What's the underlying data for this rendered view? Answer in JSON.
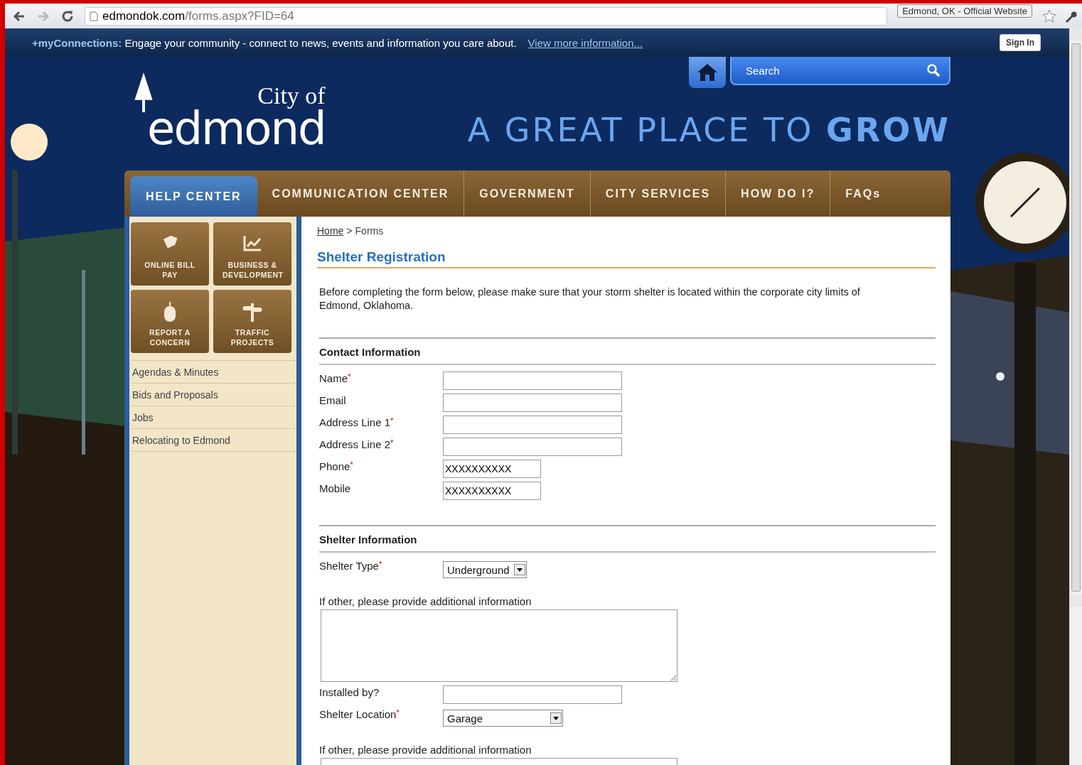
{
  "browser": {
    "url_host": "edmondok.com",
    "url_path": "/forms.aspx?FID=64",
    "page_title_tag": "Edmond, OK - Official Website"
  },
  "connections_bar": {
    "brand": "+myConnections:",
    "message": "Engage your community - connect to news, events and information you care about.",
    "link": "View more information...",
    "sign_in": "Sign In"
  },
  "header": {
    "logo_small": "City of",
    "logo_big": "edmond",
    "search": {
      "placeholder": "Search"
    },
    "tagline": "A GREAT PLACE TO **GROW**"
  },
  "nav": [
    {
      "label": "HELP CENTER",
      "selected": true
    },
    {
      "label": "COMMUNICATION CENTER",
      "selected": false
    },
    {
      "label": "GOVERNMENT",
      "selected": false
    },
    {
      "label": "CITY SERVICES",
      "selected": false
    },
    {
      "label": "HOW DO I?",
      "selected": false
    },
    {
      "label": "FAQs",
      "selected": false
    }
  ],
  "sidebar": {
    "tiles": [
      {
        "label": "ONLINE BILL PAY"
      },
      {
        "label": "BUSINESS & DEVELOPMENT"
      },
      {
        "label": "REPORT A CONCERN"
      },
      {
        "label": "TRAFFIC PROJECTS"
      }
    ],
    "links": [
      "Agendas & Minutes",
      "Bids and Proposals",
      "Jobs",
      "Relocating to Edmond"
    ]
  },
  "breadcrumb": {
    "home": "Home",
    "separator": ">",
    "current": "Forms"
  },
  "form": {
    "title": "Shelter Registration",
    "intro": "Before completing the form below, please make sure that your storm shelter is located within the corporate city limits of Edmond, Oklahoma.",
    "sections": [
      {
        "title": "Contact Information",
        "fields": [
          {
            "kind": "text",
            "label": "Name",
            "required_mark": "*"
          },
          {
            "kind": "text",
            "label": "Email"
          },
          {
            "kind": "text",
            "label": "Address Line 1",
            "required_mark": "*"
          },
          {
            "kind": "text",
            "label": "Address Line 2",
            "required_mark": "*"
          },
          {
            "kind": "short",
            "label": "Phone",
            "required_mark": "*",
            "value": "XXXXXXXXXX"
          },
          {
            "kind": "short",
            "label": "Mobile",
            "value": "XXXXXXXXXX"
          }
        ]
      },
      {
        "title": "Shelter Information",
        "fields": [
          {
            "kind": "select",
            "label": "Shelter Type",
            "required_mark": "*",
            "value": "Underground"
          },
          {
            "kind": "textarea",
            "label": "If other, please provide additional information"
          },
          {
            "kind": "text",
            "label": "Installed by?"
          },
          {
            "kind": "select_wide",
            "label": "Shelter Location",
            "required_mark": "*",
            "value": "Garage"
          },
          {
            "kind": "textarea",
            "label": "If other, please provide additional information"
          }
        ]
      }
    ]
  }
}
